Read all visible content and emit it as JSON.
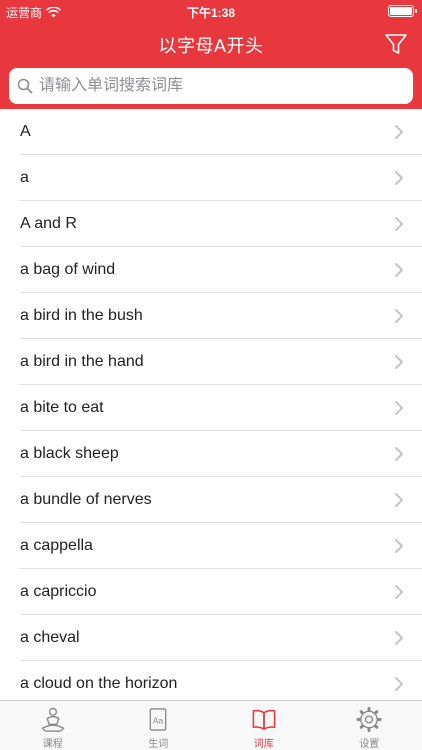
{
  "status_bar": {
    "carrier": "运营商",
    "time": "下午1:38",
    "battery_level": 1.0
  },
  "nav": {
    "title": "以字母A开头",
    "filter_icon": "filter-icon"
  },
  "search": {
    "placeholder": "请输入单词搜索词库",
    "value": ""
  },
  "list": {
    "items": [
      {
        "label": "A"
      },
      {
        "label": "a"
      },
      {
        "label": "A and R"
      },
      {
        "label": "a bag of wind"
      },
      {
        "label": "a bird in the bush"
      },
      {
        "label": "a bird in the hand"
      },
      {
        "label": "a bite to eat"
      },
      {
        "label": "a black sheep"
      },
      {
        "label": "a bundle of nerves"
      },
      {
        "label": "a cappella"
      },
      {
        "label": "a capriccio"
      },
      {
        "label": "a cheval"
      },
      {
        "label": "a cloud on the horizon"
      }
    ]
  },
  "tabbar": {
    "tabs": [
      {
        "label": "课程",
        "icon": "meditation-person-icon",
        "active": false
      },
      {
        "label": "生词",
        "icon": "dictionary-aa-icon",
        "active": false
      },
      {
        "label": "词库",
        "icon": "open-book-icon",
        "active": true
      },
      {
        "label": "设置",
        "icon": "gear-icon",
        "active": false
      }
    ]
  },
  "colors": {
    "accent": "#e8383d",
    "inactive": "#888888"
  }
}
